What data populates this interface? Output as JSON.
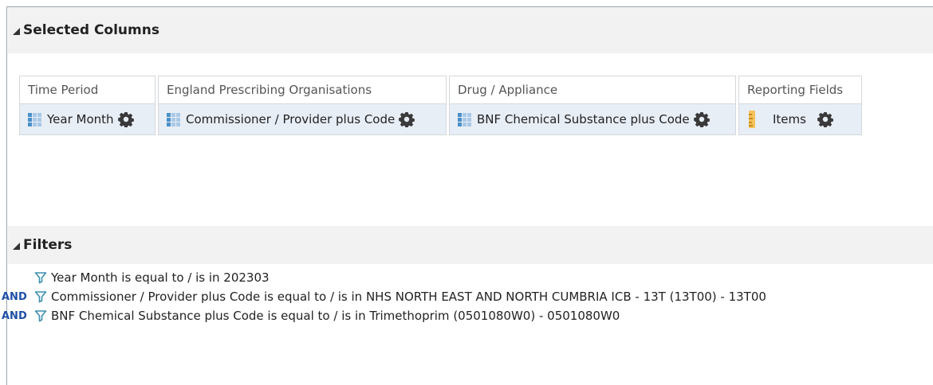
{
  "sections": {
    "selected_columns_title": "Selected Columns",
    "filters_title": "Filters"
  },
  "columns": [
    {
      "header": "Time Period",
      "item": "Year Month",
      "icon": "grid-icon"
    },
    {
      "header": "England Prescribing Organisations",
      "item": "Commissioner / Provider plus Code",
      "icon": "grid-icon"
    },
    {
      "header": "Drug / Appliance",
      "item": "BNF Chemical Substance plus Code",
      "icon": "grid-icon"
    },
    {
      "header": "Reporting Fields",
      "item": "Items",
      "icon": "ruler-icon"
    }
  ],
  "filters": [
    {
      "connector": "",
      "text": "Year Month is equal to / is in  202303"
    },
    {
      "connector": "AND",
      "text": "Commissioner / Provider plus Code is equal to / is in  NHS NORTH EAST AND NORTH CUMBRIA ICB - 13T (13T00) - 13T00"
    },
    {
      "connector": "AND",
      "text": "BNF Chemical Substance plus Code is equal to / is in  Trimethoprim (0501080W0) - 0501080W0"
    }
  ],
  "colors": {
    "accent_blue": "#1f4fa8",
    "funnel_teal": "#3c8fb0",
    "item_background": "#e8eef6",
    "measure_icon": "#f4c35a"
  }
}
